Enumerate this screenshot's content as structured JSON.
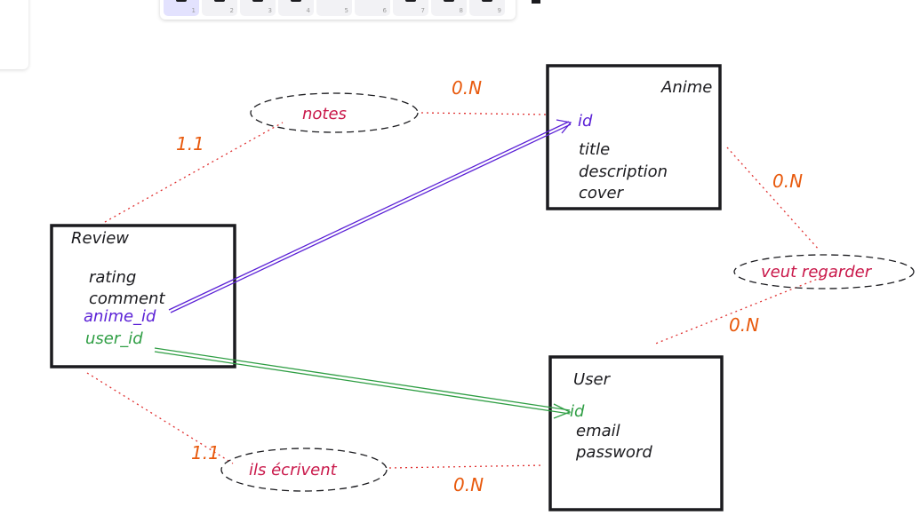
{
  "colors": {
    "ink": "#1b1b1f",
    "relation": "#c9184a",
    "cardinality": "#e8590c",
    "anime_fk": "#5b21d6",
    "user_fk": "#2f9e44",
    "toolbar_active": "#e3e2fe"
  },
  "toolbar": {
    "tools": [
      {
        "icon": "selection-icon",
        "key": "1",
        "active": true
      },
      {
        "icon": "rectangle-icon",
        "key": "2"
      },
      {
        "icon": "diamond-icon",
        "key": "3"
      },
      {
        "icon": "ellipse-icon",
        "key": "4"
      },
      {
        "icon": "arrow-icon",
        "key": "5"
      },
      {
        "icon": "line-icon",
        "key": "6"
      },
      {
        "icon": "pencil-icon",
        "key": "7"
      },
      {
        "icon": "text-icon",
        "key": "8"
      },
      {
        "icon": "image-icon",
        "key": "9"
      }
    ]
  },
  "entities": {
    "anime": {
      "title": "Anime",
      "fields": [
        "id",
        "title",
        "description",
        "cover"
      ]
    },
    "review": {
      "title": "Review",
      "fields": [
        "rating",
        "comment",
        "anime_id",
        "user_id"
      ]
    },
    "user": {
      "title": "User",
      "fields": [
        "id",
        "email",
        "password"
      ]
    }
  },
  "relations": {
    "notes": "notes",
    "veut_regarder": "veut regarder",
    "ils_ecrivent": "ils écrivent"
  },
  "cardinalities": {
    "review_notes": "1.1",
    "anime_notes": "0.N",
    "anime_regarder": "0.N",
    "user_regarder": "0.N",
    "review_ecrivent": "1.1",
    "user_ecrivent": "0.N"
  }
}
